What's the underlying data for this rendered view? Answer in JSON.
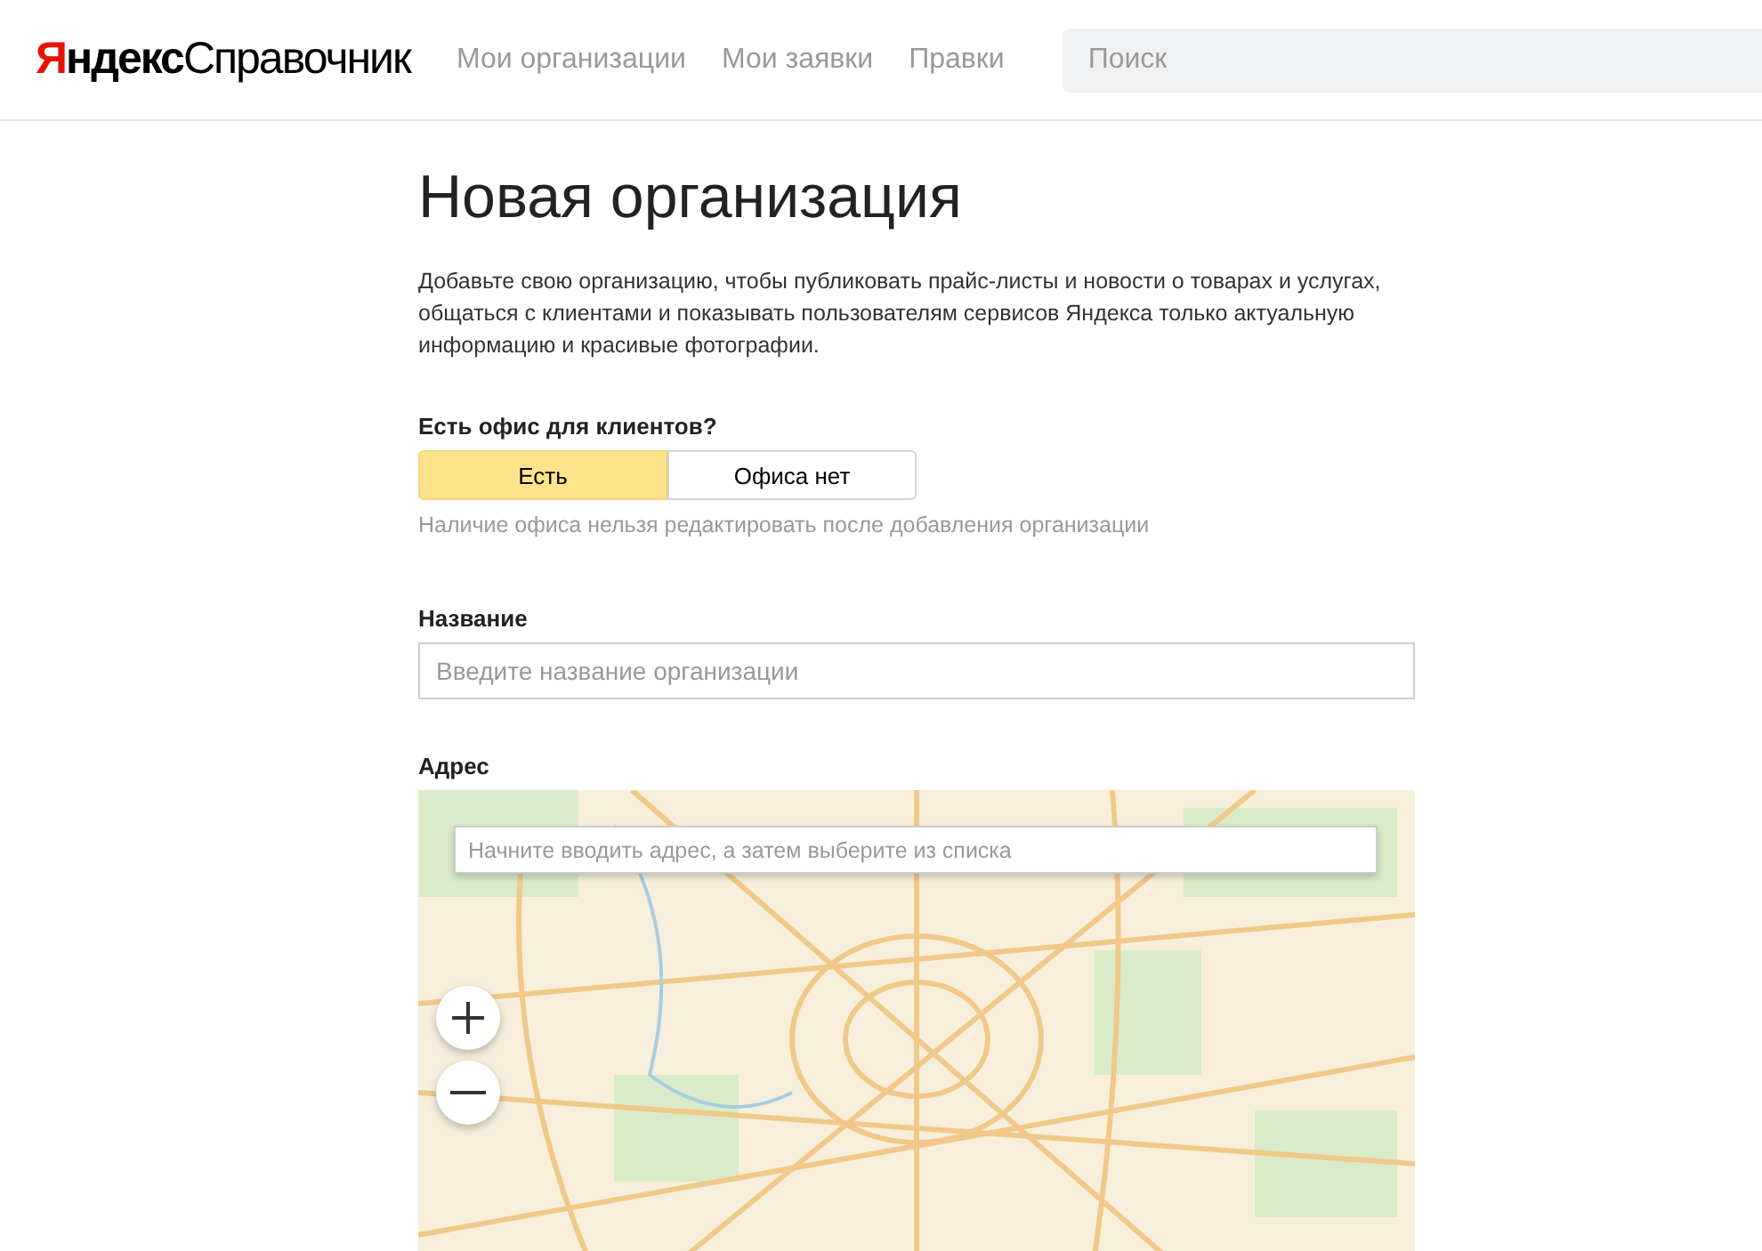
{
  "header": {
    "logo": {
      "brand": "Яндекс",
      "product": "Справочник"
    },
    "nav": [
      {
        "label": "Мои организации"
      },
      {
        "label": "Мои заявки"
      },
      {
        "label": "Правки"
      }
    ],
    "search": {
      "placeholder": "Поиск"
    }
  },
  "title": "Новая организация",
  "intro": "Добавьте свою организацию, чтобы публиковать прайс-листы и новости о товарах и услугах, общаться с клиентами и показывать пользователям сервисов Яндекса только актуальную информацию и красивые фотографии.",
  "office": {
    "label": "Есть офис для клиентов?",
    "options": [
      {
        "label": "Есть",
        "selected": true
      },
      {
        "label": "Офиса нет",
        "selected": false
      }
    ],
    "hint": "Наличие офиса нельзя редактировать после добавления организации"
  },
  "name_field": {
    "label": "Название",
    "placeholder": "Введите название организации"
  },
  "address": {
    "label": "Адрес",
    "placeholder": "Начните вводить адрес, а затем выберите из списка"
  }
}
